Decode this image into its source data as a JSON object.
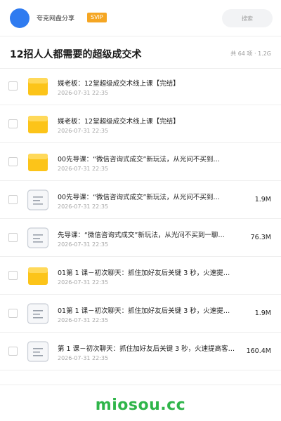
{
  "header": {
    "brand": "夸克网盘分享",
    "badge": "SVIP",
    "search_placeholder": "搜索"
  },
  "share": {
    "title": "12招人人都需要的超级成交术",
    "stats": "共 64 项 · 1.2G"
  },
  "files": [
    {
      "type": "folder",
      "name": "媒老板：12堂超级成交术线上课【完结】",
      "date": "2026-07-31 22:35",
      "size": ""
    },
    {
      "type": "folder",
      "name": "媒老板：12堂超级成交术线上课【完结】",
      "date": "2026-07-31 22:35",
      "size": ""
    },
    {
      "type": "folder",
      "name": "00先导课：“微信咨询式成交”新玩法，从光问不买到…",
      "date": "2026-07-31 22:35",
      "size": ""
    },
    {
      "type": "doc",
      "name": "00先导课：“微信咨询式成交”新玩法，从光问不买到…",
      "date": "2026-07-31 22:35",
      "size": "1.9M"
    },
    {
      "type": "doc",
      "name": "先导课：“微信咨询式成交”新玩法，从光问不买到一聊…",
      "date": "2026-07-31 22:35",
      "size": "76.3M"
    },
    {
      "type": "folder",
      "name": "01第 1 课－初次聊天：抓住加好友后关键 3 秒，火速提…",
      "date": "2026-07-31 22:35",
      "size": ""
    },
    {
      "type": "doc",
      "name": "01第 1 课－初次聊天：抓住加好友后关键 3 秒，火速提…",
      "date": "2026-07-31 22:35",
      "size": "1.9M"
    },
    {
      "type": "doc",
      "name": "第 1 课－初次聊天：抓住加好友后关键 3 秒，火速提高客…",
      "date": "2026-07-31 22:35",
      "size": "160.4M"
    }
  ],
  "watermark": "miosou.cc",
  "colors": {
    "accent": "#2f7bf0",
    "badge": "#f5a623",
    "folder": "#fcc419",
    "watermark": "#2fb54a"
  }
}
